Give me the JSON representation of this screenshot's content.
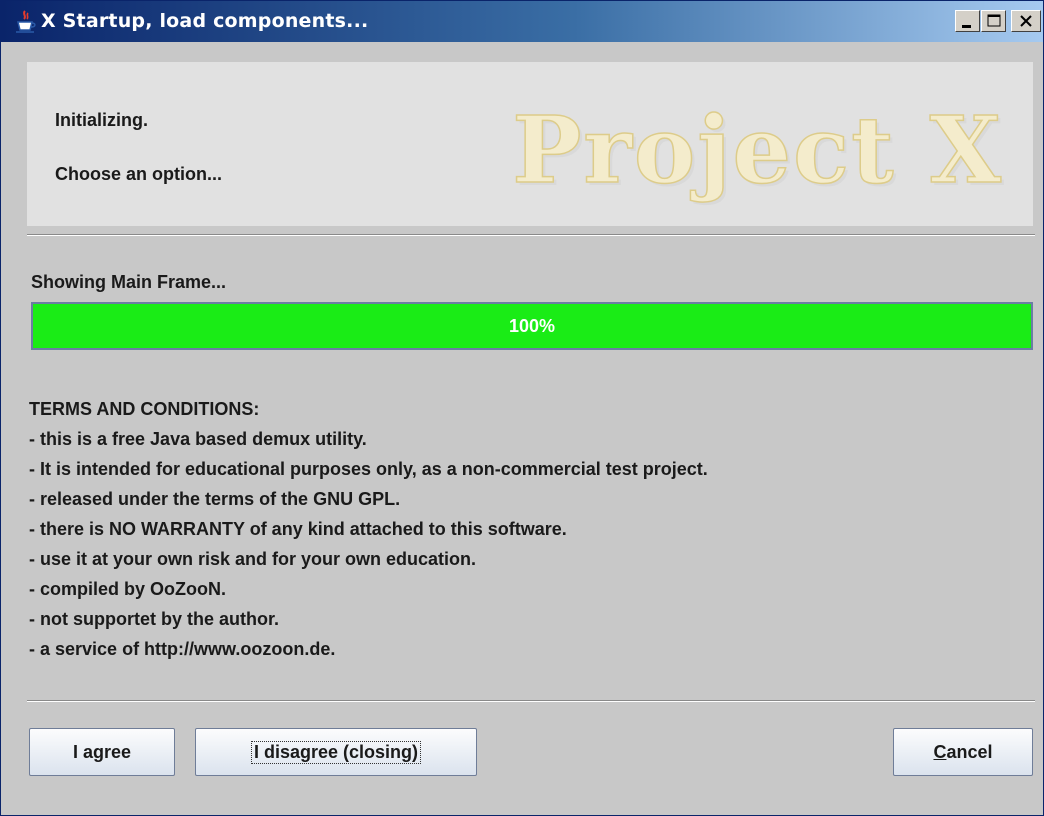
{
  "window": {
    "title": "X Startup, load components...",
    "icons": {
      "app": "java-cup-icon",
      "minimize": "minimize-icon",
      "maximize": "maximize-icon",
      "close": "close-icon"
    }
  },
  "header": {
    "line1": "Initializing.",
    "line2": "Choose an option...",
    "logo_text": "Project X"
  },
  "status": {
    "text": "Showing Main Frame...",
    "progress_value": 100,
    "progress_label": "100%",
    "progress_color": "#1aec16"
  },
  "terms": [
    "TERMS AND CONDITIONS:",
    "- this is a free Java based demux utility.",
    "- It is intended for educational purposes only, as a non-commercial test project.",
    "- released under the terms of the GNU GPL.",
    "- there is NO WARRANTY of any kind attached to this software.",
    "- use it at your own risk and for your own education.",
    "- compiled by OoZooN.",
    "- not supportet by the author.",
    "- a service of http://www.oozoon.de."
  ],
  "buttons": {
    "agree": "I agree",
    "disagree": "I disagree (closing)",
    "cancel": "Cancel"
  }
}
